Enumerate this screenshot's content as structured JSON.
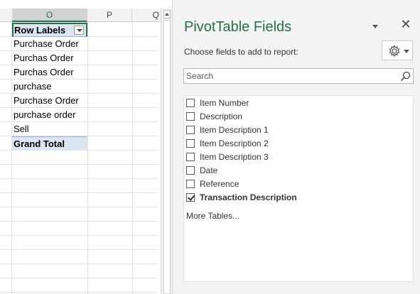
{
  "sheet": {
    "columns": [
      "O",
      "P",
      "Q"
    ],
    "pivot": {
      "header": "Row Labels",
      "rows": [
        " Purchase Order",
        "Purchas Order",
        "Purchas Order",
        "purchase",
        "Purchase  Order",
        "purchase order",
        "Sell"
      ],
      "total": "Grand Total"
    }
  },
  "pane": {
    "title": "PivotTable Fields",
    "close_label": "✕",
    "subtitle": "Choose fields to add to report:",
    "search": {
      "placeholder": "Search"
    },
    "fields": [
      {
        "label": "Item Number",
        "checked": false
      },
      {
        "label": "Description",
        "checked": false
      },
      {
        "label": "Item Description 1",
        "checked": false
      },
      {
        "label": "Item Description 2",
        "checked": false
      },
      {
        "label": "Item Description 3",
        "checked": false
      },
      {
        "label": "Date",
        "checked": false
      },
      {
        "label": "Reference",
        "checked": false
      },
      {
        "label": "Transaction Description",
        "checked": true
      }
    ],
    "more_tables": "More Tables..."
  },
  "colors": {
    "accent": "#217346",
    "pivot_fill": "#dce6f1"
  }
}
